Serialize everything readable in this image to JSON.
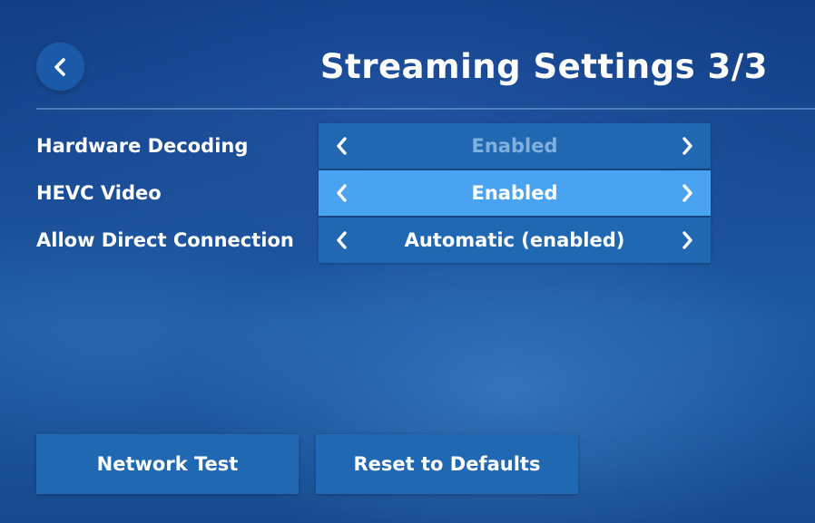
{
  "header": {
    "title": "Streaming Settings 3/3",
    "back_icon": "chevron-left-icon"
  },
  "settings": [
    {
      "label": "Hardware Decoding",
      "value": "Enabled",
      "state": "dimmed"
    },
    {
      "label": "HEVC Video",
      "value": "Enabled",
      "state": "focused"
    },
    {
      "label": "Allow Direct Connection",
      "value": "Automatic (enabled)",
      "state": "normal"
    }
  ],
  "buttons": {
    "network_test": "Network Test",
    "reset_defaults": "Reset to Defaults"
  },
  "colors": {
    "background": "#1a4f98",
    "selector": "#2068b2",
    "selector_focused": "#4aa3f0",
    "dimmed_text": "#7fb0de",
    "text": "#ffffff"
  }
}
